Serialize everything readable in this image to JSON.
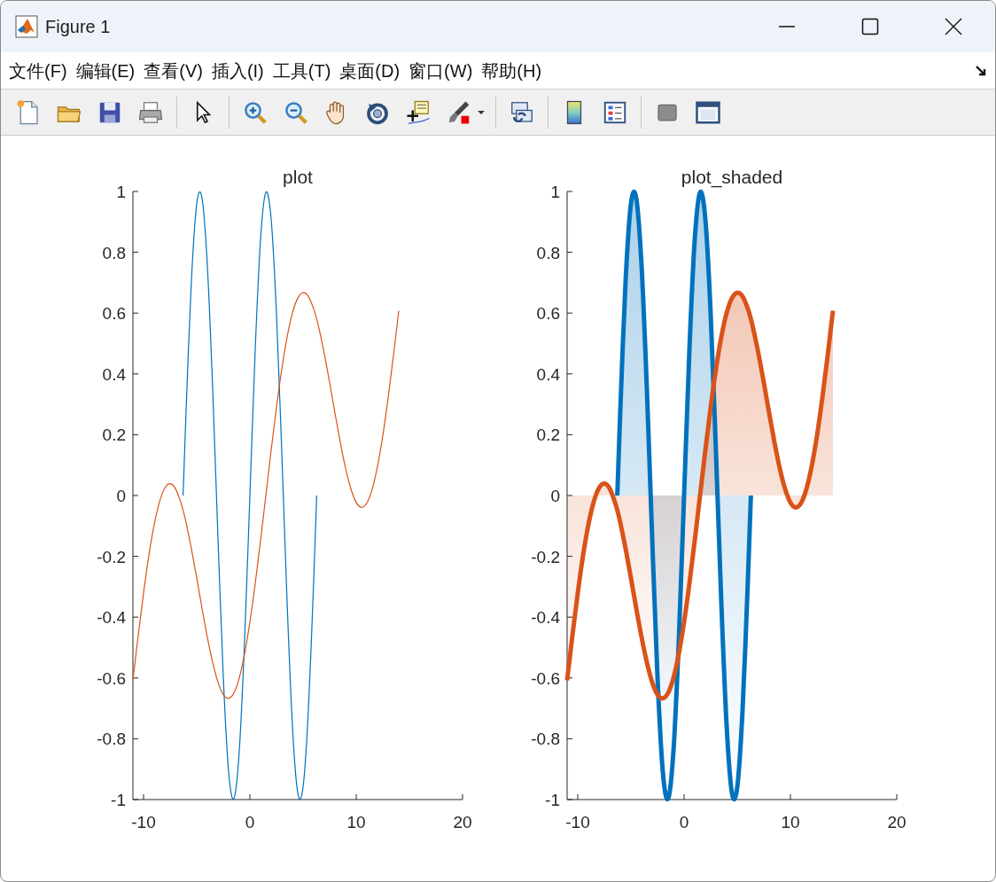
{
  "window": {
    "title": "Figure 1"
  },
  "menu": [
    "文件(F)",
    "编辑(E)",
    "查看(V)",
    "插入(I)",
    "工具(T)",
    "桌面(D)",
    "窗口(W)",
    "帮助(H)"
  ],
  "axes": [
    {
      "chart_data": {
        "type": "line",
        "title": "plot",
        "x": [
          -11,
          -10.5,
          -10,
          -9.5,
          -9,
          -8.5,
          -8,
          -7.5,
          -7,
          -6.5,
          -6.2832,
          -6,
          -5.5,
          -5,
          -4.5,
          -4,
          -3.5,
          -3,
          -2.5,
          -2,
          -1.5,
          -1,
          -0.5,
          0,
          0.5,
          1,
          1.5,
          2,
          2.5,
          3,
          3.5,
          4,
          4.5,
          5,
          5.5,
          6,
          6.2832,
          6.5,
          7,
          7.5,
          8,
          8.5,
          9,
          9.5,
          10,
          10.5,
          11,
          11.5,
          12,
          12.5,
          13,
          13.5,
          14
        ],
        "series": [
          {
            "color": "#0072bd",
            "values": [
              null,
              null,
              null,
              null,
              null,
              null,
              null,
              null,
              null,
              null,
              0,
              0.279,
              0.706,
              0.959,
              0.978,
              0.757,
              0.351,
              -0.141,
              -0.598,
              -0.909,
              -0.997,
              -0.841,
              -0.479,
              0,
              0.479,
              0.841,
              0.997,
              0.909,
              0.598,
              0.141,
              -0.351,
              -0.757,
              -0.978,
              -0.959,
              -0.706,
              -0.279,
              0,
              null,
              null,
              null,
              null,
              null,
              null,
              null,
              null,
              null,
              null,
              null,
              null,
              null,
              null,
              null,
              null
            ]
          },
          {
            "color": "#d95319",
            "values": [
              -0.608,
              -0.46,
              -0.321,
              -0.197,
              -0.096,
              -0.021,
              0.025,
              0.039,
              0.023,
              -0.022,
              -0.048,
              -0.089,
              -0.175,
              -0.271,
              -0.371,
              -0.466,
              -0.549,
              -0.614,
              -0.655,
              -0.667,
              -0.649,
              -0.6,
              -0.521,
              -0.416,
              -0.29,
              -0.149,
              0,
              0.149,
              0.29,
              0.416,
              0.521,
              0.6,
              0.649,
              0.667,
              0.655,
              0.614,
              0.58,
              0.549,
              0.466,
              0.371,
              0.271,
              0.175,
              0.089,
              0.022,
              -0.023,
              -0.039,
              -0.025,
              0.021,
              0.096,
              0.197,
              0.321,
              0.46,
              0.608
            ]
          }
        ],
        "xlim": [
          -11,
          20
        ],
        "ylim": [
          -1,
          1
        ],
        "xticks": [
          -10,
          0,
          10,
          20
        ],
        "yticks": [
          -1,
          -0.8,
          -0.6,
          -0.4,
          -0.2,
          0,
          0.2,
          0.4,
          0.6,
          0.8,
          1
        ]
      }
    },
    {
      "chart_data": {
        "type": "area",
        "title": "plot_shaded",
        "x": [
          -11,
          -10.5,
          -10,
          -9.5,
          -9,
          -8.5,
          -8,
          -7.5,
          -7,
          -6.5,
          -6.2832,
          -6,
          -5.5,
          -5,
          -4.5,
          -4,
          -3.5,
          -3,
          -2.5,
          -2,
          -1.5,
          -1,
          -0.5,
          0,
          0.5,
          1,
          1.5,
          2,
          2.5,
          3,
          3.5,
          4,
          4.5,
          5,
          5.5,
          6,
          6.2832,
          6.5,
          7,
          7.5,
          8,
          8.5,
          9,
          9.5,
          10,
          10.5,
          11,
          11.5,
          12,
          12.5,
          13,
          13.5,
          14
        ],
        "series": [
          {
            "color": "#0072bd",
            "values": [
              null,
              null,
              null,
              null,
              null,
              null,
              null,
              null,
              null,
              null,
              0,
              0.279,
              0.706,
              0.959,
              0.978,
              0.757,
              0.351,
              -0.141,
              -0.598,
              -0.909,
              -0.997,
              -0.841,
              -0.479,
              0,
              0.479,
              0.841,
              0.997,
              0.909,
              0.598,
              0.141,
              -0.351,
              -0.757,
              -0.978,
              -0.959,
              -0.706,
              -0.279,
              0,
              null,
              null,
              null,
              null,
              null,
              null,
              null,
              null,
              null,
              null,
              null,
              null,
              null,
              null,
              null,
              null
            ]
          },
          {
            "color": "#d95319",
            "values": [
              -0.608,
              -0.46,
              -0.321,
              -0.197,
              -0.096,
              -0.021,
              0.025,
              0.039,
              0.023,
              -0.022,
              -0.048,
              -0.089,
              -0.175,
              -0.271,
              -0.371,
              -0.466,
              -0.549,
              -0.614,
              -0.655,
              -0.667,
              -0.649,
              -0.6,
              -0.521,
              -0.416,
              -0.29,
              -0.149,
              0,
              0.149,
              0.29,
              0.416,
              0.521,
              0.6,
              0.649,
              0.667,
              0.655,
              0.614,
              0.58,
              0.549,
              0.466,
              0.371,
              0.271,
              0.175,
              0.089,
              0.022,
              -0.023,
              -0.039,
              -0.025,
              0.021,
              0.096,
              0.197,
              0.321,
              0.46,
              0.608
            ]
          }
        ],
        "xlim": [
          -11,
          20
        ],
        "ylim": [
          -1,
          1
        ],
        "xticks": [
          -10,
          0,
          10,
          20
        ],
        "yticks": [
          -1,
          -0.8,
          -0.6,
          -0.4,
          -0.2,
          0,
          0.2,
          0.4,
          0.6,
          0.8,
          1
        ]
      }
    }
  ]
}
